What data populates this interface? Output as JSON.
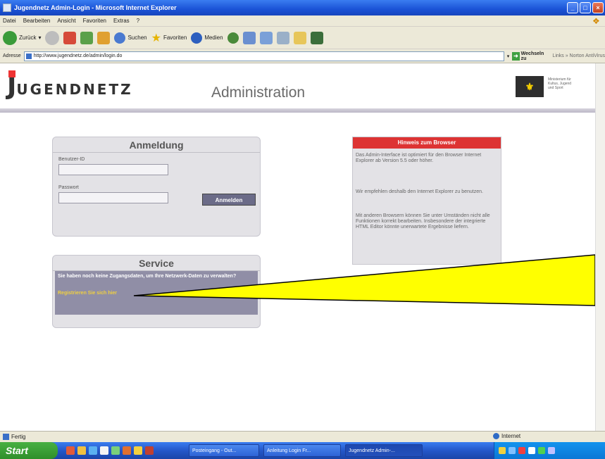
{
  "window": {
    "title": "Jugendnetz Admin-Login - Microsoft Internet Explorer",
    "controls": [
      "_",
      "□",
      "×"
    ]
  },
  "menu": [
    "Datei",
    "Bearbeiten",
    "Ansicht",
    "Favoriten",
    "Extras",
    "?"
  ],
  "toolbar": {
    "back": "Zurück",
    "search": "Suchen",
    "favorites": "Favoriten",
    "media": "Medien"
  },
  "address": {
    "label": "Adresse",
    "url": "http://www.jugendnetz.de/admin/login.do",
    "go": "Wechseln zu",
    "links": "Links » Norton AntiVirus"
  },
  "site": {
    "logo_letter": "J",
    "logo_rest": "UGENDNETZ",
    "title": "Administration",
    "ministry_lines": [
      "Ministerium für",
      "Kultus, Jugend",
      "und Sport"
    ]
  },
  "login": {
    "title": "Anmeldung",
    "user_label": "Benutzer-ID",
    "password_label": "Passwort",
    "submit_label": "Anmelden"
  },
  "service": {
    "title": "Service",
    "question": "Sie haben noch keine Zugangsdaten, um Ihre Netzwerk-Daten zu verwalten?",
    "register_link": "Registrieren Sie sich hier"
  },
  "notice": {
    "title": "Hinweis zum Browser",
    "p1": "Das Admin-Interface ist optimiert für den Browser Internet Explorer ab Version 5.5 oder höher.",
    "p2": "Wir empfehlen deshalb den Internet Explorer zu benutzen.",
    "p3": "Mit anderen Browsern können Sie unter Umständen nicht alle Funktionen korrekt bearbeiten. Insbesondere der integrierte HTML Editor könnte unerwartete Ergebnisse liefern."
  },
  "status": {
    "left": "Fertig",
    "zone": "Internet"
  },
  "taskbar": {
    "start": "Start",
    "tasks": [
      "Posteingang - Out...",
      "Anleitung Login Fr...",
      "Jugendnetz Admin-..."
    ]
  },
  "colors": {
    "accent_red": "#dd3333",
    "panel_bg": "#e3e2e6",
    "service_bg": "#908ea6",
    "callout_yellow": "#ffff00",
    "button_bg": "#6b6b88"
  }
}
